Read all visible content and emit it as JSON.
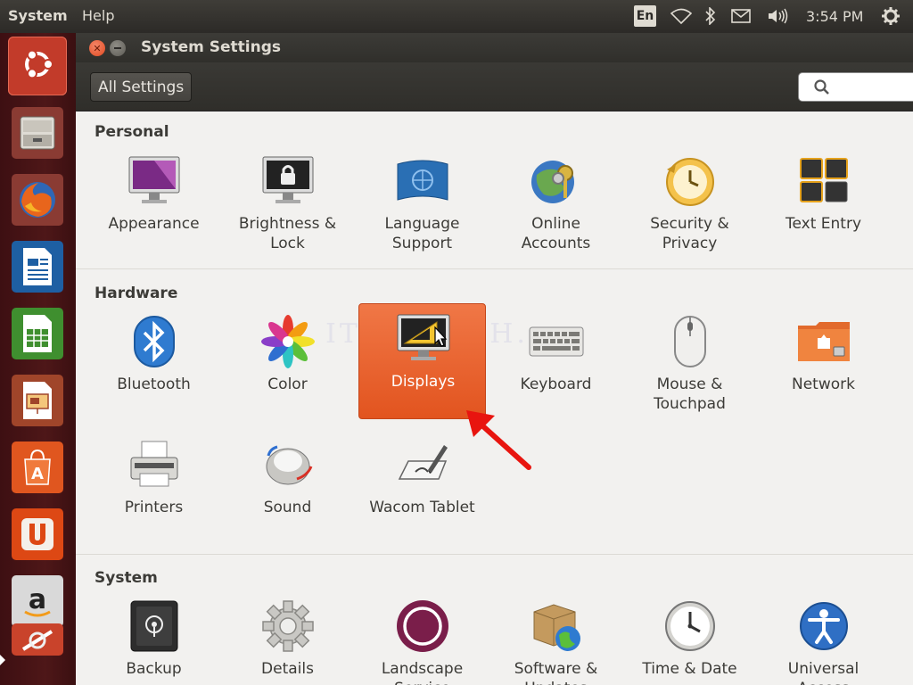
{
  "top_panel": {
    "menus": [
      "System",
      "Help"
    ],
    "keyboard_layout": "En",
    "clock": "3:54 PM",
    "indicator_icons": [
      "network-wireless-icon",
      "bluetooth-icon",
      "mail-icon",
      "volume-icon",
      "session-gear-icon"
    ]
  },
  "launcher": {
    "items": [
      {
        "name": "ubuntu-dash",
        "icon": "ubuntu-logo-icon",
        "active": true
      },
      {
        "name": "files",
        "icon": "file-cabinet-icon"
      },
      {
        "name": "firefox",
        "icon": "firefox-icon"
      },
      {
        "name": "writer",
        "icon": "writer-document-icon"
      },
      {
        "name": "calc",
        "icon": "calc-spreadsheet-icon"
      },
      {
        "name": "impress",
        "icon": "impress-presentation-icon"
      },
      {
        "name": "software-center",
        "icon": "shopping-bag-icon"
      },
      {
        "name": "ubuntu-one",
        "icon": "ubuntu-one-icon"
      },
      {
        "name": "amazon",
        "icon": "amazon-icon"
      },
      {
        "name": "system-settings",
        "icon": "settings-icon"
      }
    ]
  },
  "window": {
    "title": "System Settings",
    "all_settings_label": "All Settings",
    "search_placeholder": ""
  },
  "sections": [
    {
      "title": "Personal",
      "items": [
        {
          "label": "Appearance",
          "icon": "appearance-monitor-icon"
        },
        {
          "label": "Brightness &\nLock",
          "icon": "lock-monitor-icon"
        },
        {
          "label": "Language\nSupport",
          "icon": "language-flag-icon"
        },
        {
          "label": "Online\nAccounts",
          "icon": "online-accounts-keys-icon"
        },
        {
          "label": "Security &\nPrivacy",
          "icon": "security-clock-icon"
        },
        {
          "label": "Text Entry",
          "icon": "text-entry-keys-icon"
        }
      ]
    },
    {
      "title": "Hardware",
      "items": [
        {
          "label": "Bluetooth",
          "icon": "bluetooth-icon"
        },
        {
          "label": "Color",
          "icon": "color-flower-icon"
        },
        {
          "label": "Displays",
          "icon": "displays-monitor-icon",
          "selected": true
        },
        {
          "label": "Keyboard",
          "icon": "keyboard-icon"
        },
        {
          "label": "Mouse &\nTouchpad",
          "icon": "mouse-icon"
        },
        {
          "label": "Network",
          "icon": "network-folder-icon"
        },
        {
          "label": "Printers",
          "icon": "printer-icon"
        },
        {
          "label": "Sound",
          "icon": "sound-speaker-icon"
        },
        {
          "label": "Wacom Tablet",
          "icon": "wacom-tablet-icon"
        }
      ]
    },
    {
      "title": "System",
      "items": [
        {
          "label": "Backup",
          "icon": "backup-safe-icon"
        },
        {
          "label": "Details",
          "icon": "details-gear-icon"
        },
        {
          "label": "Landscape\nService",
          "icon": "landscape-circle-icon"
        },
        {
          "label": "Software &\nUpdates",
          "icon": "software-box-globe-icon"
        },
        {
          "label": "Time & Date",
          "icon": "clock-icon"
        },
        {
          "label": "Universal\nAccess",
          "icon": "universal-access-icon"
        }
      ]
    }
  ],
  "watermark": "IT ... His H...",
  "colors": {
    "selected": "#e95420",
    "launcher": "#4e1718",
    "panel": "#3c3b37"
  }
}
